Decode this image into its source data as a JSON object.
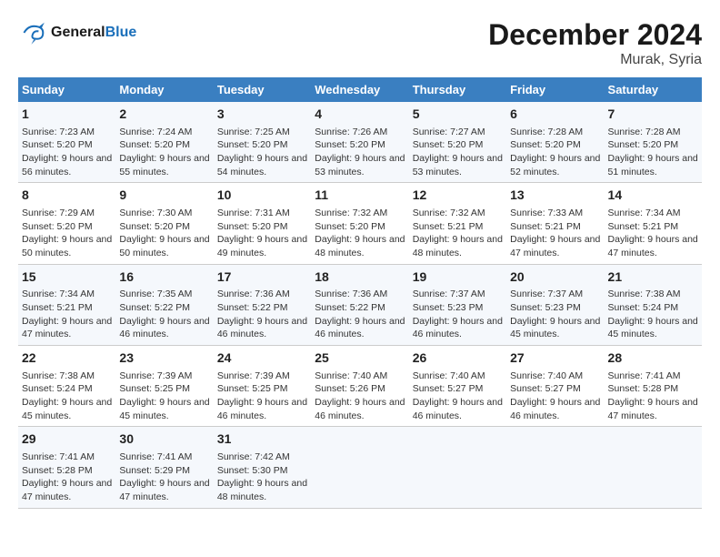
{
  "header": {
    "logo_line1": "General",
    "logo_line2": "Blue",
    "month": "December 2024",
    "location": "Murak, Syria"
  },
  "columns": [
    "Sunday",
    "Monday",
    "Tuesday",
    "Wednesday",
    "Thursday",
    "Friday",
    "Saturday"
  ],
  "weeks": [
    [
      {
        "day": "1",
        "info": "Sunrise: 7:23 AM\nSunset: 5:20 PM\nDaylight: 9 hours and 56 minutes."
      },
      {
        "day": "2",
        "info": "Sunrise: 7:24 AM\nSunset: 5:20 PM\nDaylight: 9 hours and 55 minutes."
      },
      {
        "day": "3",
        "info": "Sunrise: 7:25 AM\nSunset: 5:20 PM\nDaylight: 9 hours and 54 minutes."
      },
      {
        "day": "4",
        "info": "Sunrise: 7:26 AM\nSunset: 5:20 PM\nDaylight: 9 hours and 53 minutes."
      },
      {
        "day": "5",
        "info": "Sunrise: 7:27 AM\nSunset: 5:20 PM\nDaylight: 9 hours and 53 minutes."
      },
      {
        "day": "6",
        "info": "Sunrise: 7:28 AM\nSunset: 5:20 PM\nDaylight: 9 hours and 52 minutes."
      },
      {
        "day": "7",
        "info": "Sunrise: 7:28 AM\nSunset: 5:20 PM\nDaylight: 9 hours and 51 minutes."
      }
    ],
    [
      {
        "day": "8",
        "info": "Sunrise: 7:29 AM\nSunset: 5:20 PM\nDaylight: 9 hours and 50 minutes."
      },
      {
        "day": "9",
        "info": "Sunrise: 7:30 AM\nSunset: 5:20 PM\nDaylight: 9 hours and 50 minutes."
      },
      {
        "day": "10",
        "info": "Sunrise: 7:31 AM\nSunset: 5:20 PM\nDaylight: 9 hours and 49 minutes."
      },
      {
        "day": "11",
        "info": "Sunrise: 7:32 AM\nSunset: 5:20 PM\nDaylight: 9 hours and 48 minutes."
      },
      {
        "day": "12",
        "info": "Sunrise: 7:32 AM\nSunset: 5:21 PM\nDaylight: 9 hours and 48 minutes."
      },
      {
        "day": "13",
        "info": "Sunrise: 7:33 AM\nSunset: 5:21 PM\nDaylight: 9 hours and 47 minutes."
      },
      {
        "day": "14",
        "info": "Sunrise: 7:34 AM\nSunset: 5:21 PM\nDaylight: 9 hours and 47 minutes."
      }
    ],
    [
      {
        "day": "15",
        "info": "Sunrise: 7:34 AM\nSunset: 5:21 PM\nDaylight: 9 hours and 47 minutes."
      },
      {
        "day": "16",
        "info": "Sunrise: 7:35 AM\nSunset: 5:22 PM\nDaylight: 9 hours and 46 minutes."
      },
      {
        "day": "17",
        "info": "Sunrise: 7:36 AM\nSunset: 5:22 PM\nDaylight: 9 hours and 46 minutes."
      },
      {
        "day": "18",
        "info": "Sunrise: 7:36 AM\nSunset: 5:22 PM\nDaylight: 9 hours and 46 minutes."
      },
      {
        "day": "19",
        "info": "Sunrise: 7:37 AM\nSunset: 5:23 PM\nDaylight: 9 hours and 46 minutes."
      },
      {
        "day": "20",
        "info": "Sunrise: 7:37 AM\nSunset: 5:23 PM\nDaylight: 9 hours and 45 minutes."
      },
      {
        "day": "21",
        "info": "Sunrise: 7:38 AM\nSunset: 5:24 PM\nDaylight: 9 hours and 45 minutes."
      }
    ],
    [
      {
        "day": "22",
        "info": "Sunrise: 7:38 AM\nSunset: 5:24 PM\nDaylight: 9 hours and 45 minutes."
      },
      {
        "day": "23",
        "info": "Sunrise: 7:39 AM\nSunset: 5:25 PM\nDaylight: 9 hours and 45 minutes."
      },
      {
        "day": "24",
        "info": "Sunrise: 7:39 AM\nSunset: 5:25 PM\nDaylight: 9 hours and 46 minutes."
      },
      {
        "day": "25",
        "info": "Sunrise: 7:40 AM\nSunset: 5:26 PM\nDaylight: 9 hours and 46 minutes."
      },
      {
        "day": "26",
        "info": "Sunrise: 7:40 AM\nSunset: 5:27 PM\nDaylight: 9 hours and 46 minutes."
      },
      {
        "day": "27",
        "info": "Sunrise: 7:40 AM\nSunset: 5:27 PM\nDaylight: 9 hours and 46 minutes."
      },
      {
        "day": "28",
        "info": "Sunrise: 7:41 AM\nSunset: 5:28 PM\nDaylight: 9 hours and 47 minutes."
      }
    ],
    [
      {
        "day": "29",
        "info": "Sunrise: 7:41 AM\nSunset: 5:28 PM\nDaylight: 9 hours and 47 minutes."
      },
      {
        "day": "30",
        "info": "Sunrise: 7:41 AM\nSunset: 5:29 PM\nDaylight: 9 hours and 47 minutes."
      },
      {
        "day": "31",
        "info": "Sunrise: 7:42 AM\nSunset: 5:30 PM\nDaylight: 9 hours and 48 minutes."
      },
      {
        "day": "",
        "info": ""
      },
      {
        "day": "",
        "info": ""
      },
      {
        "day": "",
        "info": ""
      },
      {
        "day": "",
        "info": ""
      }
    ]
  ]
}
